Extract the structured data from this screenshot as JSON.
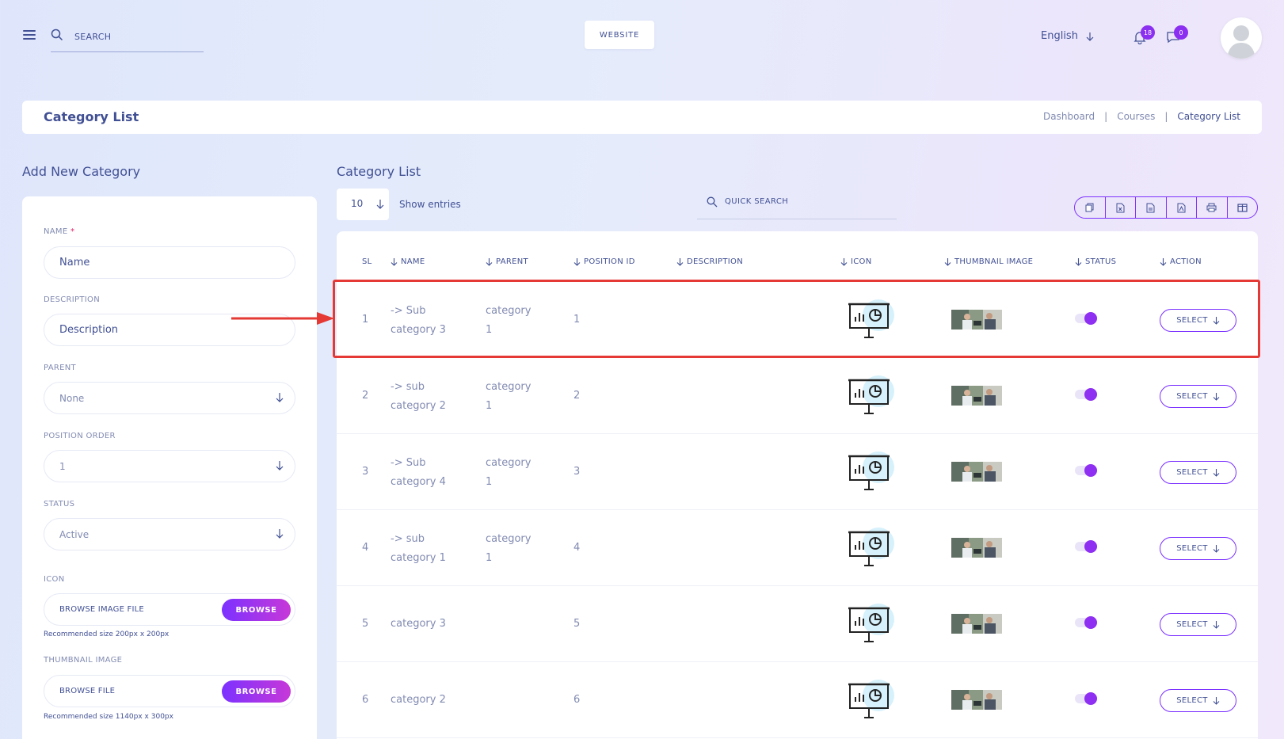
{
  "header": {
    "search_placeholder": "SEARCH",
    "website_label": "WEBSITE",
    "language": "English",
    "notifications_count": "18",
    "messages_count": "0"
  },
  "titlebar": {
    "title": "Category List",
    "breadcrumbs": [
      "Dashboard",
      "Courses",
      "Category List"
    ],
    "separator": "|"
  },
  "form": {
    "heading": "Add New Category",
    "name_label": "NAME",
    "required_mark": "*",
    "name_placeholder": "Name",
    "description_label": "DESCRIPTION",
    "description_placeholder": "Description",
    "parent_label": "PARENT",
    "parent_value": "None",
    "position_label": "POSITION ORDER",
    "position_value": "1",
    "status_label": "STATUS",
    "status_value": "Active",
    "icon_label": "ICON",
    "icon_file_text": "BROWSE IMAGE FILE",
    "icon_browse": "BROWSE",
    "icon_hint": "Recommended size 200px x 200px",
    "thumb_label": "THUMBNAIL IMAGE",
    "thumb_file_text": "BROWSE FILE",
    "thumb_browse": "BROWSE",
    "thumb_hint": "Recommended size 1140px x 300px"
  },
  "list": {
    "heading": "Category List",
    "entries_value": "10",
    "show_entries": "Show entries",
    "quick_search": "QUICK SEARCH",
    "columns": [
      "SL",
      "NAME",
      "PARENT",
      "POSITION ID",
      "DESCRIPTION",
      "ICON",
      "THUMBNAIL IMAGE",
      "STATUS",
      "ACTION"
    ],
    "select_label": "SELECT",
    "rows": [
      {
        "sl": "1",
        "name1": "-> Sub",
        "name2": "category 3",
        "parent1": "category",
        "parent2": "1",
        "pos": "1"
      },
      {
        "sl": "2",
        "name1": "-> sub",
        "name2": "category 2",
        "parent1": "category",
        "parent2": "1",
        "pos": "2"
      },
      {
        "sl": "3",
        "name1": "-> Sub",
        "name2": "category 4",
        "parent1": "category",
        "parent2": "1",
        "pos": "3"
      },
      {
        "sl": "4",
        "name1": "-> sub",
        "name2": "category 1",
        "parent1": "category",
        "parent2": "1",
        "pos": "4"
      },
      {
        "sl": "5",
        "name1": "category 3",
        "name2": "",
        "parent1": "",
        "parent2": "",
        "pos": "5"
      },
      {
        "sl": "6",
        "name1": "category 2",
        "name2": "",
        "parent1": "",
        "parent2": "",
        "pos": "6"
      }
    ]
  },
  "colors": {
    "accent": "#7c32ff",
    "text": "#415094",
    "muted": "#828bb2",
    "highlight": "#e53935"
  }
}
